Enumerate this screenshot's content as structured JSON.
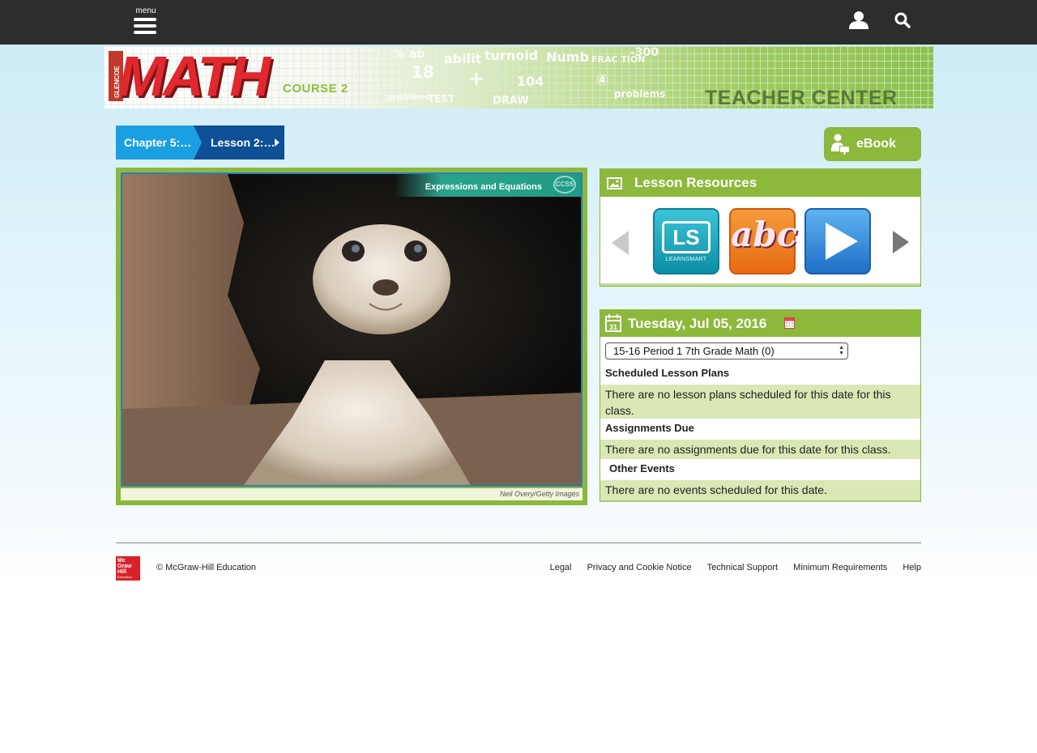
{
  "topbar": {
    "menu_label": "menu",
    "icons": [
      "menu-icon",
      "user-icon",
      "search-icon"
    ]
  },
  "banner": {
    "brand": "GLENCOE",
    "title": "MATH",
    "course": "COURSE 2",
    "center": "TEACHER CENTER"
  },
  "breadcrumb": {
    "chapter": "Chapter 5:…",
    "lesson": "Lesson 2:…"
  },
  "ebook": {
    "label": "eBook"
  },
  "lesson_image": {
    "header": "Expressions and Equations",
    "badge": "CCSS",
    "credit": "Neil Overy/Getty Images"
  },
  "resources": {
    "title": "Lesson Resources",
    "items": [
      {
        "name": "LearnSmart",
        "tile_text": "LS",
        "tile_sub": "LEARNSMART",
        "color": "#1aa6bd"
      },
      {
        "name": "Vocabulary",
        "tile_text": "abc",
        "color": "#ee7b22"
      },
      {
        "name": "Video",
        "icon": "play-icon",
        "color": "#2f86d6"
      }
    ]
  },
  "calendar": {
    "date": "Tuesday, Jul 05, 2016",
    "class_select": "15-16 Period 1 7th Grade Math (0)",
    "sections": [
      {
        "label": "Scheduled Lesson Plans",
        "message": "There are no lesson plans scheduled for this date for this class."
      },
      {
        "label": "Assignments Due",
        "message": "There are no assignments due for this date for this class."
      },
      {
        "label": "Other Events",
        "message": "There are no events scheduled for this date."
      }
    ]
  },
  "footer": {
    "logo_lines": [
      "Mc",
      "Graw",
      "Hill",
      "Education"
    ],
    "copyright": "© McGraw-Hill Education",
    "links": [
      "Legal",
      "Privacy and Cookie Notice",
      "Technical Support",
      "Minimum Requirements",
      "Help"
    ]
  },
  "colors": {
    "topbar": "#2d2d2d",
    "accent_green": "#8cb83c",
    "crumb_light": "#1b9fe3",
    "crumb_dark": "#0e4f96",
    "row_green": "#d9e8b4",
    "brand_red": "#d8222a"
  }
}
